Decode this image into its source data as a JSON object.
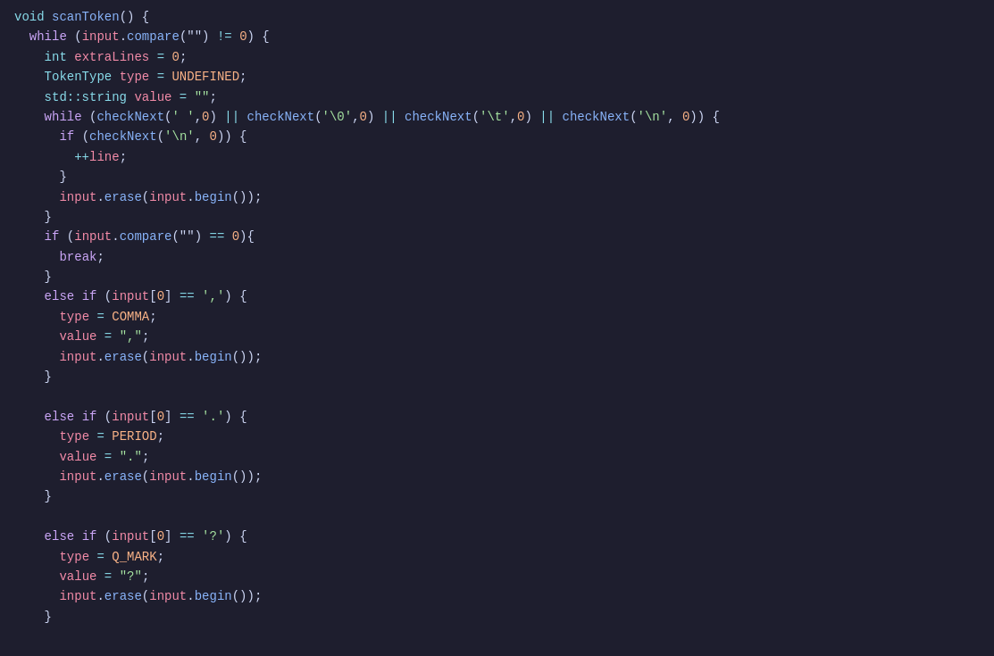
{
  "code": {
    "lines": [
      {
        "id": 1,
        "tokens": [
          {
            "t": "kw-void",
            "v": "void"
          },
          {
            "t": "plain",
            "v": " "
          },
          {
            "t": "fn",
            "v": "scanToken"
          },
          {
            "t": "plain",
            "v": "() {"
          }
        ]
      },
      {
        "id": 2,
        "tokens": [
          {
            "t": "plain",
            "v": "  "
          },
          {
            "t": "kw-while",
            "v": "while"
          },
          {
            "t": "plain",
            "v": " ("
          },
          {
            "t": "input-kw",
            "v": "input"
          },
          {
            "t": "plain",
            "v": "."
          },
          {
            "t": "fn",
            "v": "compare"
          },
          {
            "t": "plain",
            "v": "(\"\""
          },
          {
            "t": "plain",
            "v": ") "
          },
          {
            "t": "op",
            "v": "!="
          },
          {
            "t": "plain",
            "v": " "
          },
          {
            "t": "num",
            "v": "0"
          },
          {
            "t": "plain",
            "v": ") {"
          }
        ]
      },
      {
        "id": 3,
        "tokens": [
          {
            "t": "plain",
            "v": "    "
          },
          {
            "t": "kw-type",
            "v": "int"
          },
          {
            "t": "plain",
            "v": " "
          },
          {
            "t": "var-name",
            "v": "extraLines"
          },
          {
            "t": "plain",
            "v": " "
          },
          {
            "t": "assign-eq",
            "v": "="
          },
          {
            "t": "plain",
            "v": " "
          },
          {
            "t": "num",
            "v": "0"
          },
          {
            "t": "plain",
            "v": ";"
          }
        ]
      },
      {
        "id": 4,
        "tokens": [
          {
            "t": "plain",
            "v": "    "
          },
          {
            "t": "kw-type",
            "v": "TokenType"
          },
          {
            "t": "plain",
            "v": " "
          },
          {
            "t": "var-name",
            "v": "type"
          },
          {
            "t": "plain",
            "v": " "
          },
          {
            "t": "assign-eq",
            "v": "="
          },
          {
            "t": "plain",
            "v": " "
          },
          {
            "t": "const-val",
            "v": "UNDEFINED"
          },
          {
            "t": "plain",
            "v": ";"
          }
        ]
      },
      {
        "id": 5,
        "tokens": [
          {
            "t": "plain",
            "v": "    "
          },
          {
            "t": "kw-type",
            "v": "std::string"
          },
          {
            "t": "plain",
            "v": " "
          },
          {
            "t": "var-name",
            "v": "value"
          },
          {
            "t": "plain",
            "v": " "
          },
          {
            "t": "assign-eq",
            "v": "="
          },
          {
            "t": "plain",
            "v": " "
          },
          {
            "t": "str",
            "v": "\"\""
          },
          {
            "t": "plain",
            "v": ";"
          }
        ]
      },
      {
        "id": 6,
        "tokens": [
          {
            "t": "plain",
            "v": "    "
          },
          {
            "t": "kw-while",
            "v": "while"
          },
          {
            "t": "plain",
            "v": " ("
          },
          {
            "t": "fn",
            "v": "checkNext"
          },
          {
            "t": "plain",
            "v": "("
          },
          {
            "t": "char",
            "v": "' '"
          },
          {
            "t": "plain",
            "v": ","
          },
          {
            "t": "num",
            "v": "0"
          },
          {
            "t": "plain",
            "v": ") "
          },
          {
            "t": "op",
            "v": "||"
          },
          {
            "t": "plain",
            "v": " "
          },
          {
            "t": "fn",
            "v": "checkNext"
          },
          {
            "t": "plain",
            "v": "("
          },
          {
            "t": "char",
            "v": "'\\0'"
          },
          {
            "t": "plain",
            "v": ","
          },
          {
            "t": "num",
            "v": "0"
          },
          {
            "t": "plain",
            "v": ") "
          },
          {
            "t": "op",
            "v": "||"
          },
          {
            "t": "plain",
            "v": " "
          },
          {
            "t": "fn",
            "v": "checkNext"
          },
          {
            "t": "plain",
            "v": "("
          },
          {
            "t": "char",
            "v": "'\\t'"
          },
          {
            "t": "plain",
            "v": ","
          },
          {
            "t": "num",
            "v": "0"
          },
          {
            "t": "plain",
            "v": ") "
          },
          {
            "t": "op",
            "v": "||"
          },
          {
            "t": "plain",
            "v": " "
          },
          {
            "t": "fn",
            "v": "checkNext"
          },
          {
            "t": "plain",
            "v": "("
          },
          {
            "t": "char",
            "v": "'\\n'"
          },
          {
            "t": "plain",
            "v": ", "
          },
          {
            "t": "num",
            "v": "0"
          },
          {
            "t": "plain",
            "v": ")) {"
          }
        ]
      },
      {
        "id": 7,
        "tokens": [
          {
            "t": "plain",
            "v": "      "
          },
          {
            "t": "kw-if",
            "v": "if"
          },
          {
            "t": "plain",
            "v": " ("
          },
          {
            "t": "fn",
            "v": "checkNext"
          },
          {
            "t": "plain",
            "v": "("
          },
          {
            "t": "char",
            "v": "'\\n'"
          },
          {
            "t": "plain",
            "v": ", "
          },
          {
            "t": "num",
            "v": "0"
          },
          {
            "t": "plain",
            "v": ")) {"
          }
        ]
      },
      {
        "id": 8,
        "tokens": [
          {
            "t": "plain",
            "v": "        "
          },
          {
            "t": "op",
            "v": "++"
          },
          {
            "t": "var-name",
            "v": "line"
          },
          {
            "t": "plain",
            "v": ";"
          }
        ]
      },
      {
        "id": 9,
        "tokens": [
          {
            "t": "plain",
            "v": "      }"
          }
        ]
      },
      {
        "id": 10,
        "tokens": [
          {
            "t": "plain",
            "v": "      "
          },
          {
            "t": "input-kw",
            "v": "input"
          },
          {
            "t": "plain",
            "v": "."
          },
          {
            "t": "fn",
            "v": "erase"
          },
          {
            "t": "plain",
            "v": "("
          },
          {
            "t": "input-kw",
            "v": "input"
          },
          {
            "t": "plain",
            "v": "."
          },
          {
            "t": "fn",
            "v": "begin"
          },
          {
            "t": "plain",
            "v": "());"
          }
        ]
      },
      {
        "id": 11,
        "tokens": [
          {
            "t": "plain",
            "v": "    }"
          }
        ]
      },
      {
        "id": 12,
        "tokens": [
          {
            "t": "plain",
            "v": "    "
          },
          {
            "t": "kw-if",
            "v": "if"
          },
          {
            "t": "plain",
            "v": " ("
          },
          {
            "t": "input-kw",
            "v": "input"
          },
          {
            "t": "plain",
            "v": "."
          },
          {
            "t": "fn",
            "v": "compare"
          },
          {
            "t": "plain",
            "v": "(\"\") "
          },
          {
            "t": "op",
            "v": "=="
          },
          {
            "t": "plain",
            "v": " "
          },
          {
            "t": "num",
            "v": "0"
          },
          {
            "t": "plain",
            "v": "){"
          }
        ]
      },
      {
        "id": 13,
        "tokens": [
          {
            "t": "plain",
            "v": "      "
          },
          {
            "t": "kw-break",
            "v": "break"
          },
          {
            "t": "plain",
            "v": ";"
          }
        ]
      },
      {
        "id": 14,
        "tokens": [
          {
            "t": "plain",
            "v": "    }"
          }
        ]
      },
      {
        "id": 15,
        "tokens": [
          {
            "t": "plain",
            "v": "    "
          },
          {
            "t": "kw-else",
            "v": "else"
          },
          {
            "t": "plain",
            "v": " "
          },
          {
            "t": "kw-if",
            "v": "if"
          },
          {
            "t": "plain",
            "v": " ("
          },
          {
            "t": "input-kw",
            "v": "input"
          },
          {
            "t": "plain",
            "v": "["
          },
          {
            "t": "num",
            "v": "0"
          },
          {
            "t": "plain",
            "v": "] "
          },
          {
            "t": "op",
            "v": "=="
          },
          {
            "t": "plain",
            "v": " "
          },
          {
            "t": "char",
            "v": "','"
          },
          {
            "t": "plain",
            "v": ") {"
          }
        ]
      },
      {
        "id": 16,
        "tokens": [
          {
            "t": "plain",
            "v": "      "
          },
          {
            "t": "var-name",
            "v": "type"
          },
          {
            "t": "plain",
            "v": " "
          },
          {
            "t": "assign-eq",
            "v": "="
          },
          {
            "t": "plain",
            "v": " "
          },
          {
            "t": "const-val",
            "v": "COMMA"
          },
          {
            "t": "plain",
            "v": ";"
          }
        ]
      },
      {
        "id": 17,
        "tokens": [
          {
            "t": "plain",
            "v": "      "
          },
          {
            "t": "var-name",
            "v": "value"
          },
          {
            "t": "plain",
            "v": " "
          },
          {
            "t": "assign-eq",
            "v": "="
          },
          {
            "t": "plain",
            "v": " "
          },
          {
            "t": "str",
            "v": "\",\""
          },
          {
            "t": "plain",
            "v": ";"
          }
        ]
      },
      {
        "id": 18,
        "tokens": [
          {
            "t": "plain",
            "v": "      "
          },
          {
            "t": "input-kw",
            "v": "input"
          },
          {
            "t": "plain",
            "v": "."
          },
          {
            "t": "fn",
            "v": "erase"
          },
          {
            "t": "plain",
            "v": "("
          },
          {
            "t": "input-kw",
            "v": "input"
          },
          {
            "t": "plain",
            "v": "."
          },
          {
            "t": "fn",
            "v": "begin"
          },
          {
            "t": "plain",
            "v": "());"
          }
        ]
      },
      {
        "id": 19,
        "tokens": [
          {
            "t": "plain",
            "v": "    }"
          }
        ]
      },
      {
        "id": 20,
        "tokens": []
      },
      {
        "id": 21,
        "tokens": [
          {
            "t": "plain",
            "v": "    "
          },
          {
            "t": "kw-else",
            "v": "else"
          },
          {
            "t": "plain",
            "v": " "
          },
          {
            "t": "kw-if",
            "v": "if"
          },
          {
            "t": "plain",
            "v": " ("
          },
          {
            "t": "input-kw",
            "v": "input"
          },
          {
            "t": "plain",
            "v": "["
          },
          {
            "t": "num",
            "v": "0"
          },
          {
            "t": "plain",
            "v": "] "
          },
          {
            "t": "op",
            "v": "=="
          },
          {
            "t": "plain",
            "v": " "
          },
          {
            "t": "char",
            "v": "'.'"
          },
          {
            "t": "plain",
            "v": ") {"
          }
        ]
      },
      {
        "id": 22,
        "tokens": [
          {
            "t": "plain",
            "v": "      "
          },
          {
            "t": "var-name",
            "v": "type"
          },
          {
            "t": "plain",
            "v": " "
          },
          {
            "t": "assign-eq",
            "v": "="
          },
          {
            "t": "plain",
            "v": " "
          },
          {
            "t": "const-val",
            "v": "PERIOD"
          },
          {
            "t": "plain",
            "v": ";"
          }
        ]
      },
      {
        "id": 23,
        "tokens": [
          {
            "t": "plain",
            "v": "      "
          },
          {
            "t": "var-name",
            "v": "value"
          },
          {
            "t": "plain",
            "v": " "
          },
          {
            "t": "assign-eq",
            "v": "="
          },
          {
            "t": "plain",
            "v": " "
          },
          {
            "t": "str",
            "v": "\".\""
          },
          {
            "t": "plain",
            "v": ";"
          }
        ]
      },
      {
        "id": 24,
        "tokens": [
          {
            "t": "plain",
            "v": "      "
          },
          {
            "t": "input-kw",
            "v": "input"
          },
          {
            "t": "plain",
            "v": "."
          },
          {
            "t": "fn",
            "v": "erase"
          },
          {
            "t": "plain",
            "v": "("
          },
          {
            "t": "input-kw",
            "v": "input"
          },
          {
            "t": "plain",
            "v": "."
          },
          {
            "t": "fn",
            "v": "begin"
          },
          {
            "t": "plain",
            "v": "());"
          }
        ]
      },
      {
        "id": 25,
        "tokens": [
          {
            "t": "plain",
            "v": "    }"
          }
        ]
      },
      {
        "id": 26,
        "tokens": []
      },
      {
        "id": 27,
        "tokens": [
          {
            "t": "plain",
            "v": "    "
          },
          {
            "t": "kw-else",
            "v": "else"
          },
          {
            "t": "plain",
            "v": " "
          },
          {
            "t": "kw-if",
            "v": "if"
          },
          {
            "t": "plain",
            "v": " ("
          },
          {
            "t": "input-kw",
            "v": "input"
          },
          {
            "t": "plain",
            "v": "["
          },
          {
            "t": "num",
            "v": "0"
          },
          {
            "t": "plain",
            "v": "] "
          },
          {
            "t": "op",
            "v": "=="
          },
          {
            "t": "plain",
            "v": " "
          },
          {
            "t": "char",
            "v": "'?'"
          },
          {
            "t": "plain",
            "v": ") {"
          }
        ]
      },
      {
        "id": 28,
        "tokens": [
          {
            "t": "plain",
            "v": "      "
          },
          {
            "t": "var-name",
            "v": "type"
          },
          {
            "t": "plain",
            "v": " "
          },
          {
            "t": "assign-eq",
            "v": "="
          },
          {
            "t": "plain",
            "v": " "
          },
          {
            "t": "const-val",
            "v": "Q_MARK"
          },
          {
            "t": "plain",
            "v": ";"
          }
        ]
      },
      {
        "id": 29,
        "tokens": [
          {
            "t": "plain",
            "v": "      "
          },
          {
            "t": "var-name",
            "v": "value"
          },
          {
            "t": "plain",
            "v": " "
          },
          {
            "t": "assign-eq",
            "v": "="
          },
          {
            "t": "plain",
            "v": " "
          },
          {
            "t": "str",
            "v": "\"?\""
          },
          {
            "t": "plain",
            "v": ";"
          }
        ]
      },
      {
        "id": 30,
        "tokens": [
          {
            "t": "plain",
            "v": "      "
          },
          {
            "t": "input-kw",
            "v": "input"
          },
          {
            "t": "plain",
            "v": "."
          },
          {
            "t": "fn",
            "v": "erase"
          },
          {
            "t": "plain",
            "v": "("
          },
          {
            "t": "input-kw",
            "v": "input"
          },
          {
            "t": "plain",
            "v": "."
          },
          {
            "t": "fn",
            "v": "begin"
          },
          {
            "t": "plain",
            "v": "());"
          }
        ]
      },
      {
        "id": 31,
        "tokens": [
          {
            "t": "plain",
            "v": "    }"
          }
        ]
      }
    ]
  }
}
